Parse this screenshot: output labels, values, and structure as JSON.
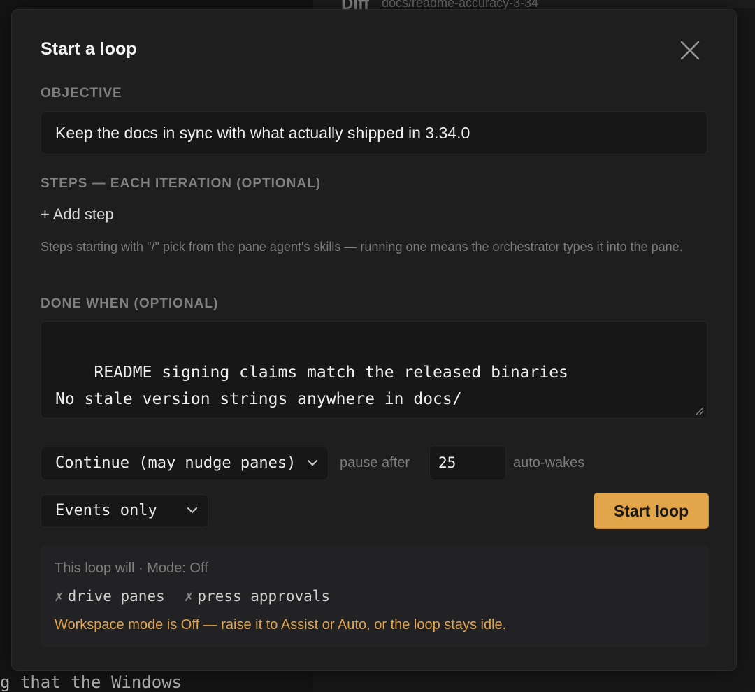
{
  "background": {
    "top_right_title": "Diff",
    "top_right_path": "docs/readme-accuracy-3-34",
    "bottom_text": "g that the Windows"
  },
  "modal": {
    "title": "Start a loop",
    "close_icon": "close-icon",
    "objective": {
      "label": "OBJECTIVE",
      "value": "Keep the docs in sync with what actually shipped in 3.34.0"
    },
    "steps": {
      "label": "STEPS — EACH ITERATION (OPTIONAL)",
      "add_label": "+ Add step",
      "hint": "Steps starting with \"/\" pick from the pane agent's skills — running one means the orchestrator types it into the pane."
    },
    "done_when": {
      "label": "DONE WHEN (OPTIONAL)",
      "value": "README signing claims match the released binaries\nNo stale version strings anywhere in docs/"
    },
    "continue_select": {
      "value": "Continue (may nudge panes)"
    },
    "pause_label": "pause after",
    "pause_value": "25",
    "autowakes_label": "auto-wakes",
    "events_select": {
      "value": "Events only"
    },
    "start_button": "Start loop",
    "summary": {
      "title": "This loop will · Mode: Off",
      "flag_1": "drive panes",
      "flag_2": "press approvals",
      "x_glyph": "✗",
      "warning": "Workspace mode is Off — raise it to Assist or Auto, or the loop stays idle."
    }
  },
  "colors": {
    "accent": "#e3a54a",
    "modal_bg": "#1e1e1f",
    "field_bg": "#171717"
  }
}
